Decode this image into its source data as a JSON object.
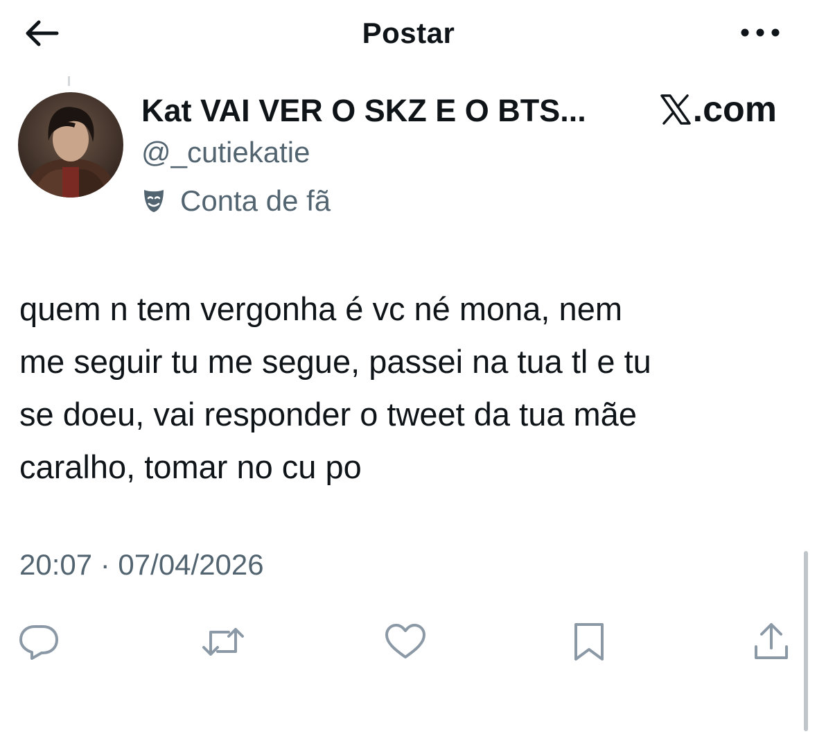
{
  "header": {
    "title": "Postar",
    "back_icon": "arrow-left-icon",
    "more_icon": "more-horizontal-icon"
  },
  "author": {
    "display_name": "Kat VAI VER O SKZ E O BTS...",
    "handle": "@_cutiekatie",
    "label": "Conta de fã",
    "label_icon": "theater-mask-icon"
  },
  "watermark": {
    "text": ".com",
    "logo_icon": "x-logo-icon"
  },
  "tweet": {
    "text": "quem n tem vergonha é vc né mona, nem\nme seguir tu me segue, passei na tua tl e tu\nse doeu, vai responder o tweet da tua mãe\ncaralho, tomar no cu po",
    "timestamp": "20:07 · 07/04/2026"
  },
  "actions": [
    {
      "name": "reply",
      "icon": "reply-icon"
    },
    {
      "name": "repost",
      "icon": "repost-icon"
    },
    {
      "name": "like",
      "icon": "heart-icon"
    },
    {
      "name": "bookmark",
      "icon": "bookmark-icon"
    },
    {
      "name": "share",
      "icon": "share-icon"
    }
  ],
  "colors": {
    "text_primary": "#0f1419",
    "text_secondary": "#536471",
    "icon_gray": "#8b98a5",
    "background": "#ffffff"
  }
}
